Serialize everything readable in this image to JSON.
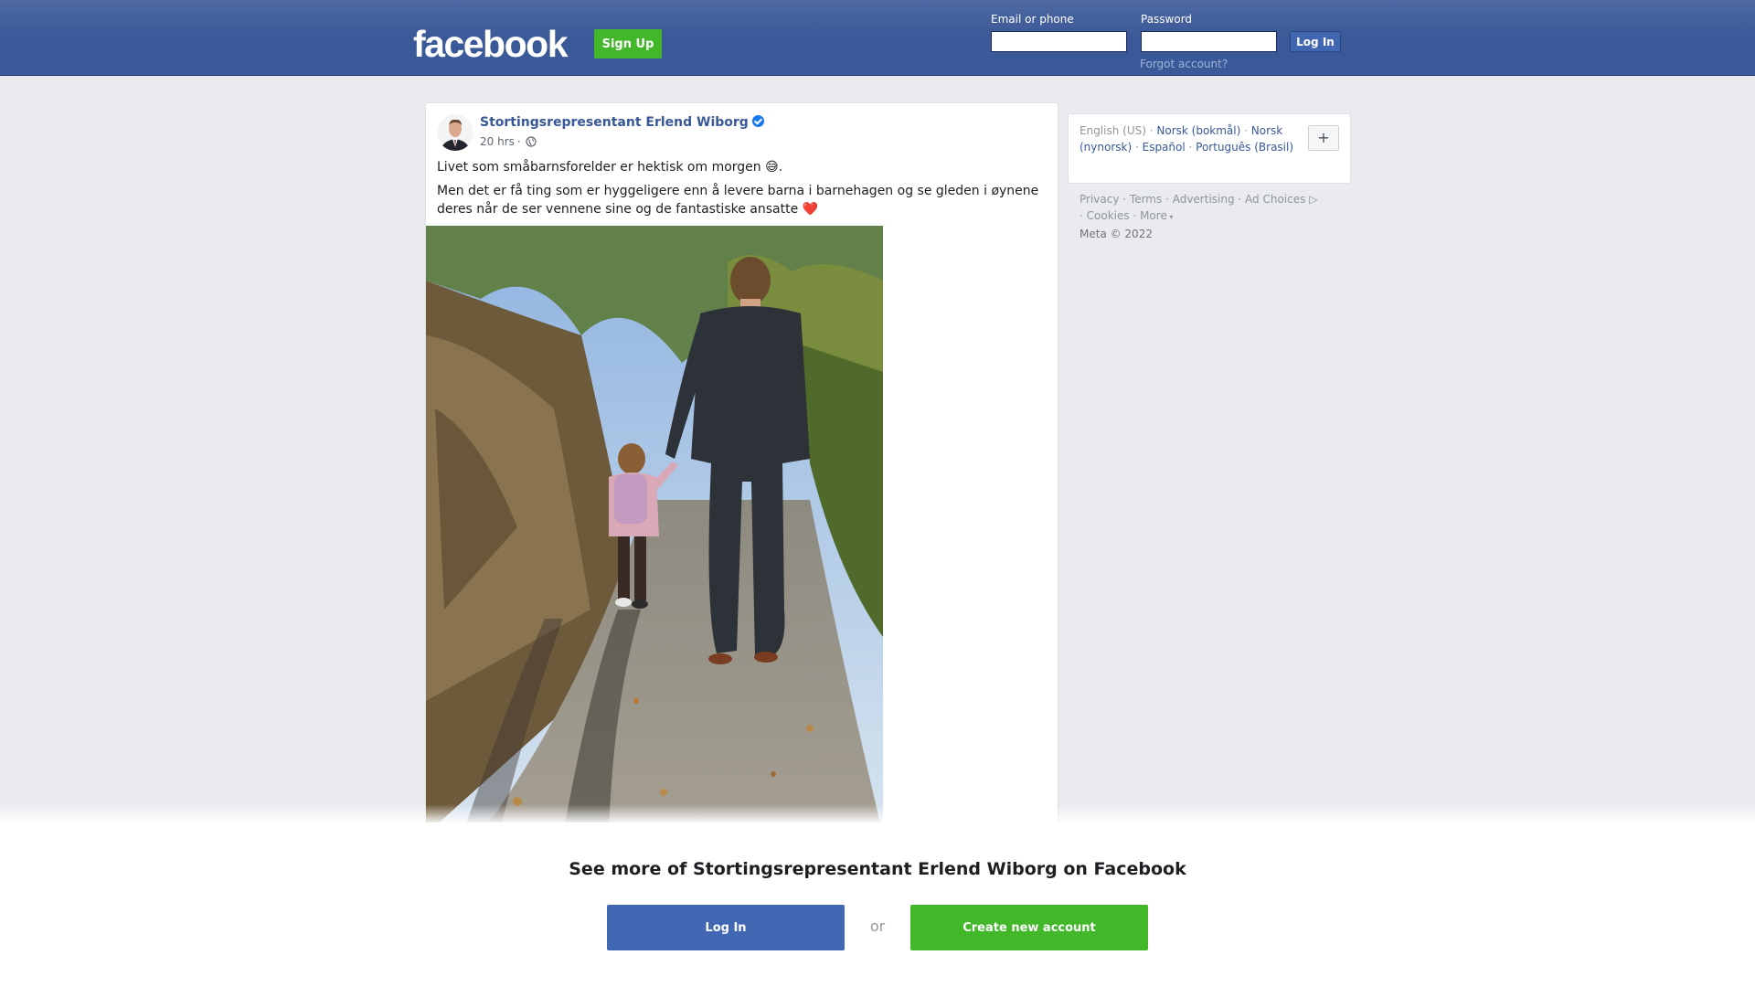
{
  "header": {
    "logo": "facebook",
    "signup_label": "Sign Up",
    "email_label": "Email or phone",
    "password_label": "Password",
    "login_label": "Log In",
    "forgot_label": "Forgot account?"
  },
  "post": {
    "author": "Stortingsrepresentant Erlend Wiborg",
    "verified": true,
    "time": "20 hrs",
    "privacy_icon": "globe-icon",
    "text_line1": "Livet som småbarnsforelder er hektisk om morgen 😅.",
    "text_line2": "Men det er få ting som er hyggeligere enn å levere barna i barnehagen og se gleden i øynene deres når de ser vennene sine og de fantastiske ansatte ❤️",
    "photo_icon": "post-photo"
  },
  "languages": {
    "current": "English (US)",
    "items": [
      "Norsk (bokmål)",
      "Norsk (nynorsk)",
      "Español",
      "Português (Brasil)"
    ],
    "more_icon": "plus-icon"
  },
  "footer": {
    "links": [
      "Privacy",
      "Terms",
      "Advertising",
      "Ad Choices",
      "Cookies",
      "More"
    ],
    "copyright": "Meta © 2022"
  },
  "overlay": {
    "headline": "See more of Stortingsrepresentant Erlend Wiborg on Facebook",
    "login_label": "Log In",
    "or_label": "or",
    "create_label": "Create new account"
  },
  "colors": {
    "brand_blue": "#3b5998",
    "button_blue": "#4267b2",
    "signup_green": "#42b72a",
    "link_blue": "#385898"
  }
}
